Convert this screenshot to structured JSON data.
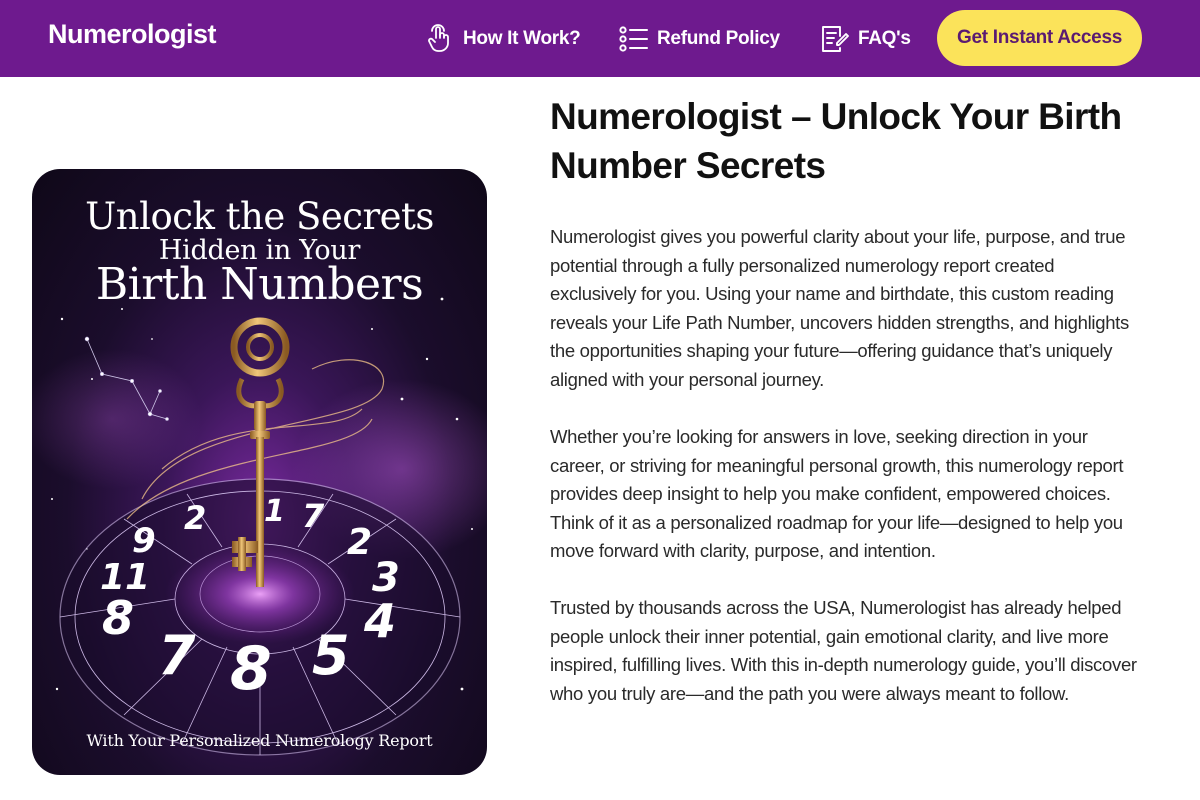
{
  "navbar": {
    "brand": "Numerologist",
    "links": [
      {
        "label": "How It Work?",
        "icon": "hand-pointer-icon"
      },
      {
        "label": "Refund Policy",
        "icon": "list-icon"
      },
      {
        "label": "FAQ's",
        "icon": "document-edit-icon"
      }
    ],
    "cta_label": "Get Instant Access",
    "colors": {
      "background": "#6e1a8e",
      "cta": "#fbe35a",
      "cta_text": "#5a1a72"
    }
  },
  "product_image": {
    "title_line1": "Unlock the Secrets",
    "title_line2": "Hidden in Your",
    "title_line3": "Birth Numbers",
    "subtitle": "With Your Personalized Numerology Report",
    "dial_numbers": [
      "1",
      "7",
      "2",
      "3",
      "4",
      "5",
      "8",
      "7",
      "8",
      "11",
      "9",
      "2"
    ]
  },
  "main": {
    "headline": "Numerologist – Unlock Your Birth Number Secrets",
    "paragraphs": [
      "Numerologist gives you powerful clarity about your life, purpose, and true potential through a fully personalized numerology report created exclusively for you. Using your name and birthdate, this custom reading reveals your Life Path Number, uncovers hidden strengths, and highlights the opportunities shaping your future—offering guidance that’s uniquely aligned with your personal journey.",
      "Whether you’re looking for answers in love, seeking direction in your career, or striving for meaningful personal growth, this numerology report provides deep insight to help you make confident, empowered choices. Think of it as a personalized roadmap for your life—designed to help you move forward with clarity, purpose, and intention.",
      "Trusted by thousands across the USA, Numerologist has already helped people unlock their inner potential, gain emotional clarity, and live more inspired, fulfilling lives. With this in-depth numerology guide, you’ll discover who you truly are—and the path you were always meant to follow."
    ]
  }
}
